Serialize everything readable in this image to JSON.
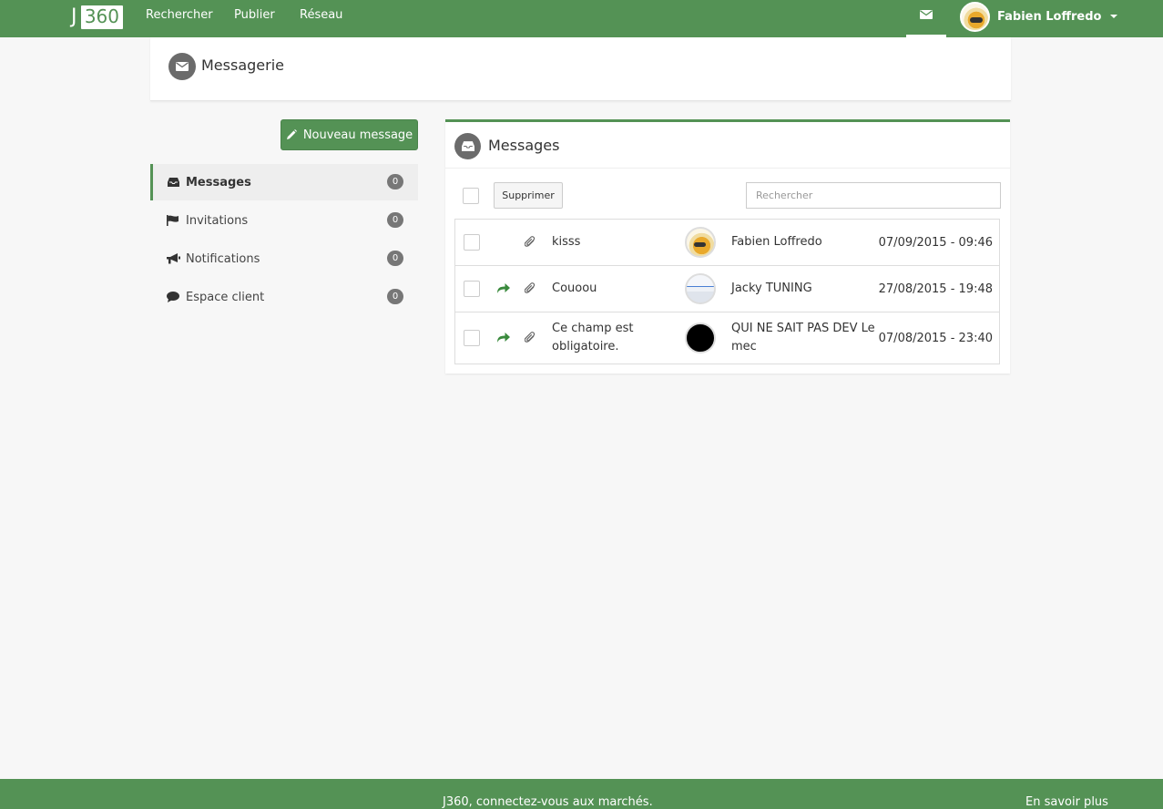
{
  "navbar": {
    "logo_j": "J",
    "logo_box": "360",
    "links": [
      "Rechercher",
      "Publier",
      "Réseau"
    ],
    "user_name": "Fabien Loffredo",
    "colors": {
      "brand": "#549255"
    }
  },
  "header": {
    "title": "Messagerie"
  },
  "sidebar": {
    "new_button": "Nouveau message",
    "items": [
      {
        "label": "Messages",
        "count": "0",
        "icon": "inbox-icon"
      },
      {
        "label": "Invitations",
        "count": "0",
        "icon": "flag-icon"
      },
      {
        "label": "Notifications",
        "count": "0",
        "icon": "bullhorn-icon"
      },
      {
        "label": "Espace client",
        "count": "0",
        "icon": "comment-icon"
      }
    ]
  },
  "messages_panel": {
    "title": "Messages",
    "delete_label": "Supprimer",
    "search_placeholder": "Rechercher",
    "rows": [
      {
        "replied": false,
        "subject": "kisss",
        "sender": "Fabien Loffredo",
        "date": "07/09/2015 - 09:46",
        "avatar": "cartoon"
      },
      {
        "replied": true,
        "subject": "Couoou",
        "sender": "Jacky TUNING",
        "date": "27/08/2015 - 19:48",
        "avatar": "screenshot"
      },
      {
        "replied": true,
        "subject": "Ce champ est obligatoire.",
        "sender": "QUI NE SAIT PAS DEV Le mec",
        "date": "07/08/2015 - 23:40",
        "avatar": "black"
      }
    ]
  },
  "footer": {
    "tagline": "J360, connectez-vous aux marchés.",
    "more_link": "En savoir plus"
  }
}
